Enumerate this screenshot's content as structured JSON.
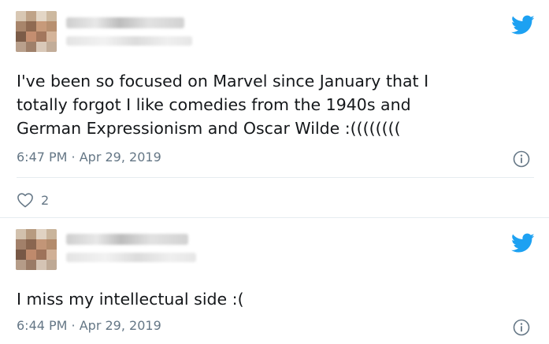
{
  "tweets": [
    {
      "text": "I've been so focused on Marvel since January that I\ntotally forgot I like comedies from the 1940s and\nGerman Expressionism and Oscar Wilde :((((((((",
      "timestamp": "6:47 PM · Apr 29, 2019",
      "likes": "2"
    },
    {
      "text": "I miss my intellectual side :(",
      "timestamp": "6:44 PM · Apr 29, 2019"
    }
  ],
  "colors": {
    "twitter_blue": "#1da1f2",
    "meta_gray": "#657786",
    "divider": "#e6ecf0"
  },
  "icons": [
    "twitter-bird-icon",
    "info-icon",
    "heart-icon"
  ]
}
